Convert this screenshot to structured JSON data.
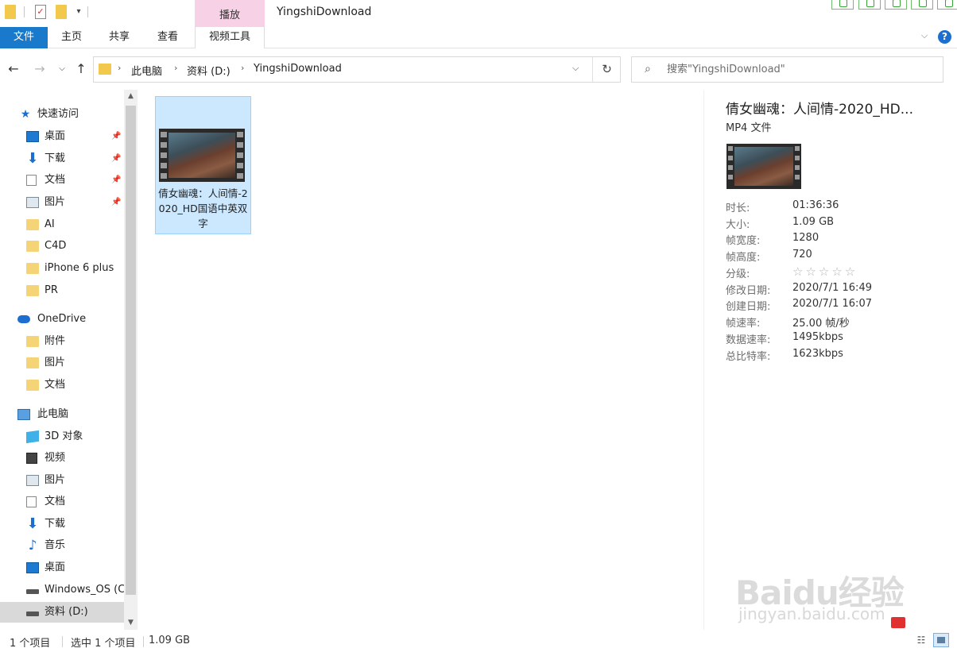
{
  "window": {
    "title": "YingshiDownload",
    "contextual_tab_group": "播放"
  },
  "ribbon": {
    "tabs": [
      "文件",
      "主页",
      "共享",
      "查看",
      "视频工具"
    ],
    "active_tab_color": "#1979ca",
    "contextual_color": "#f7d2e6"
  },
  "address": {
    "breadcrumbs": [
      "此电脑",
      "资料 (D:)",
      "YingshiDownload"
    ]
  },
  "search": {
    "placeholder": "搜索\"YingshiDownload\""
  },
  "nav": {
    "quick_access": "快速访问",
    "quick_items": [
      {
        "label": "桌面",
        "icon": "desktop-icon",
        "pinned": true
      },
      {
        "label": "下载",
        "icon": "download-icon",
        "pinned": true
      },
      {
        "label": "文档",
        "icon": "document-icon",
        "pinned": true
      },
      {
        "label": "图片",
        "icon": "picture-icon",
        "pinned": true
      },
      {
        "label": "AI",
        "icon": "folder-icon",
        "pinned": false
      },
      {
        "label": "C4D",
        "icon": "folder-icon",
        "pinned": false
      },
      {
        "label": "iPhone 6 plus",
        "icon": "folder-icon",
        "pinned": false
      },
      {
        "label": "PR",
        "icon": "folder-icon",
        "pinned": false
      }
    ],
    "onedrive": "OneDrive",
    "onedrive_items": [
      {
        "label": "附件",
        "icon": "folder-icon"
      },
      {
        "label": "图片",
        "icon": "folder-icon"
      },
      {
        "label": "文档",
        "icon": "folder-icon"
      }
    ],
    "this_pc": "此电脑",
    "pc_items": [
      {
        "label": "3D 对象",
        "icon": "3d-objects-icon"
      },
      {
        "label": "视频",
        "icon": "video-icon"
      },
      {
        "label": "图片",
        "icon": "picture-icon"
      },
      {
        "label": "文档",
        "icon": "document-icon"
      },
      {
        "label": "下载",
        "icon": "download-icon"
      },
      {
        "label": "音乐",
        "icon": "music-icon"
      },
      {
        "label": "桌面",
        "icon": "desktop-icon"
      },
      {
        "label": "Windows_OS (C",
        "icon": "drive-icon"
      },
      {
        "label": "资料 (D:)",
        "icon": "drive-icon",
        "selected": true
      }
    ]
  },
  "content": {
    "file": {
      "name": "倩女幽魂：人间情-2020_HD国语中英双字",
      "selected": true
    }
  },
  "details": {
    "title": "倩女幽魂：人间情-2020_HD...",
    "type": "MP4 文件",
    "properties": [
      {
        "label": "时长:",
        "value": "01:36:36"
      },
      {
        "label": "大小:",
        "value": "1.09 GB"
      },
      {
        "label": "帧宽度:",
        "value": "1280"
      },
      {
        "label": "帧高度:",
        "value": "720"
      },
      {
        "label": "分级:",
        "value": "☆☆☆☆☆",
        "rating": 0,
        "rating_max": 5
      },
      {
        "label": "修改日期:",
        "value": "2020/7/1 16:49"
      },
      {
        "label": "创建日期:",
        "value": "2020/7/1 16:07"
      },
      {
        "label": "帧速率:",
        "value": "25.00 帧/秒"
      },
      {
        "label": "数据速率:",
        "value": "1495kbps"
      },
      {
        "label": "总比特率:",
        "value": "1623kbps"
      }
    ]
  },
  "status": {
    "item_count": "1 个项目",
    "selected": "选中 1 个项目",
    "size": "1.09 GB"
  },
  "watermark": {
    "logo": "Baidu经验",
    "url": "jingyan.baidu.com"
  }
}
